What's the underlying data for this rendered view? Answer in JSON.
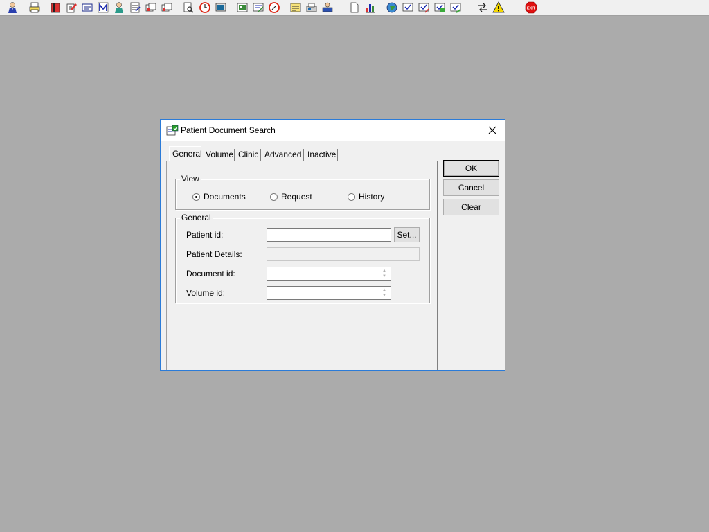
{
  "toolbar": {
    "icons": [
      "user-icon",
      "printer-icon",
      "book-icon",
      "edit-form-icon",
      "scanner-icon",
      "m-letter-icon",
      "doctor-icon",
      "notepad-icon",
      "chart-stack-icon",
      "chart-stack-icon-2",
      "search-doc-icon",
      "clock-icon",
      "monitor-icon",
      "picture-icon",
      "screen-edit-icon",
      "clock-edit-icon",
      "note-icon",
      "fax-icon",
      "print-user-icon",
      "blank-page-icon",
      "bar-chart-icon",
      "globe-icon",
      "checklist-icon",
      "checklist-icon-2",
      "checklist-green-icon",
      "checklist-arrow-icon",
      "transfer-icon",
      "warning-icon",
      "exit-icon"
    ],
    "exit_label": "EXIT"
  },
  "dialog": {
    "title": "Patient Document Search",
    "tabs": [
      "General",
      "Volume",
      "Clinic",
      "Advanced",
      "Inactive"
    ],
    "active_tab": "General",
    "view_group": {
      "legend": "View",
      "options": [
        "Documents",
        "Request",
        "History"
      ],
      "selected": "Documents"
    },
    "general_group": {
      "legend": "General",
      "patient_id_label": "Patient id:",
      "patient_id_value": "",
      "set_button": "Set...",
      "patient_details_label": "Patient Details:",
      "patient_details_value": "",
      "document_id_label": "Document id:",
      "document_id_value": "",
      "volume_id_label": "Volume id:",
      "volume_id_value": ""
    },
    "buttons": {
      "ok": "OK",
      "cancel": "Cancel",
      "clear": "Clear"
    }
  },
  "colors": {
    "desktop": "#ababab",
    "dialog_border": "#2b7bd8",
    "panel": "#f0f0f0"
  }
}
